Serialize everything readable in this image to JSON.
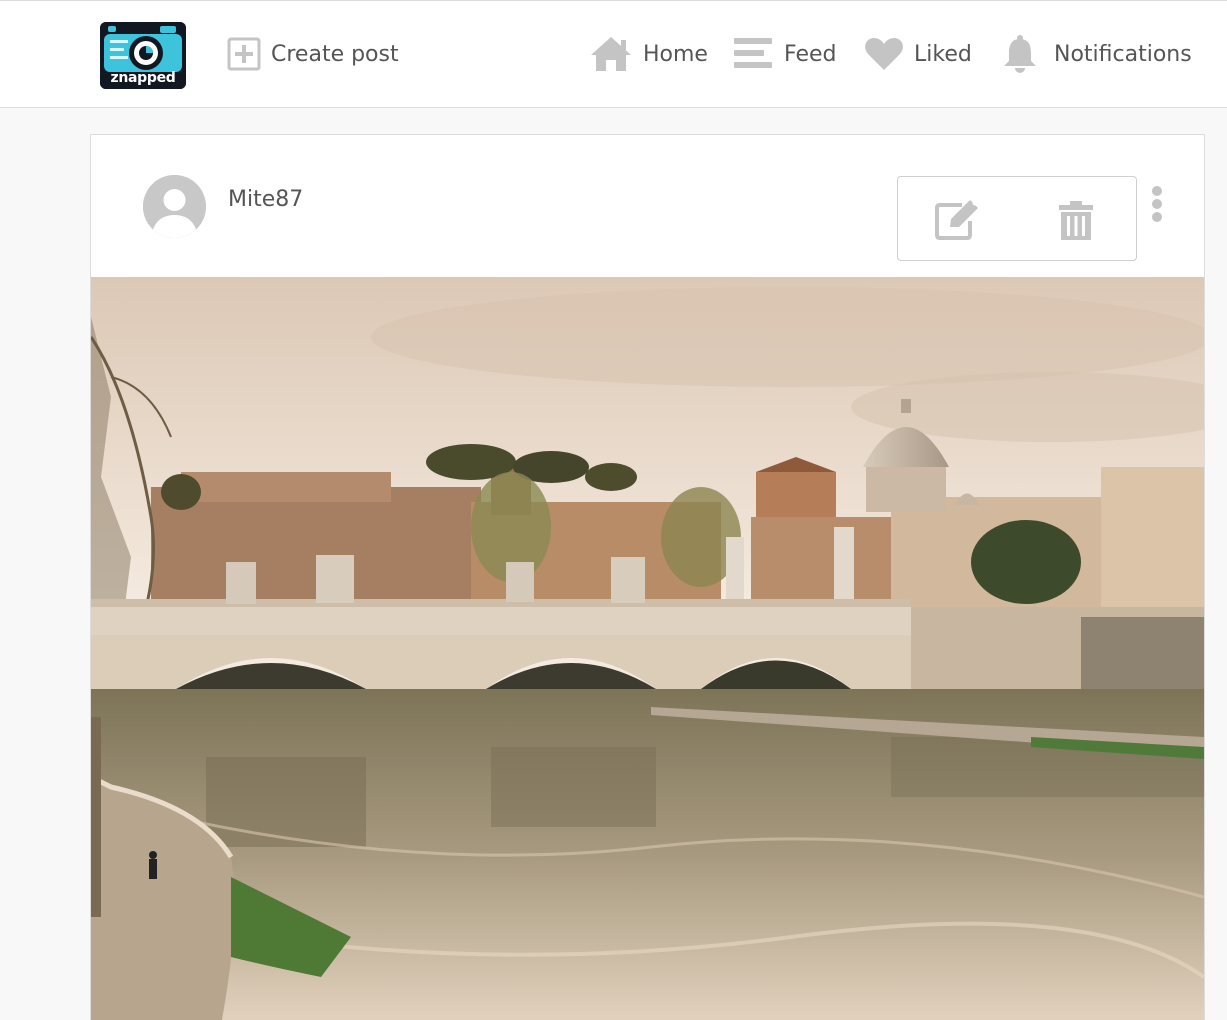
{
  "app": {
    "logo_text": "znapped"
  },
  "nav": {
    "create_post": "Create post",
    "home": "Home",
    "feed": "Feed",
    "liked": "Liked",
    "notifications": "Notifications"
  },
  "post": {
    "username": "Mite87",
    "image_icon": "photo-bridge-river-dome"
  },
  "menu": {
    "edit_icon": "edit-icon",
    "delete_icon": "trash-icon",
    "more_icon": "vertical-dots-icon"
  },
  "colors": {
    "icon_gray": "#c4c4c4",
    "text_gray": "#555555",
    "border": "#dcdcdc",
    "logo_accent": "#3ec3dd"
  }
}
